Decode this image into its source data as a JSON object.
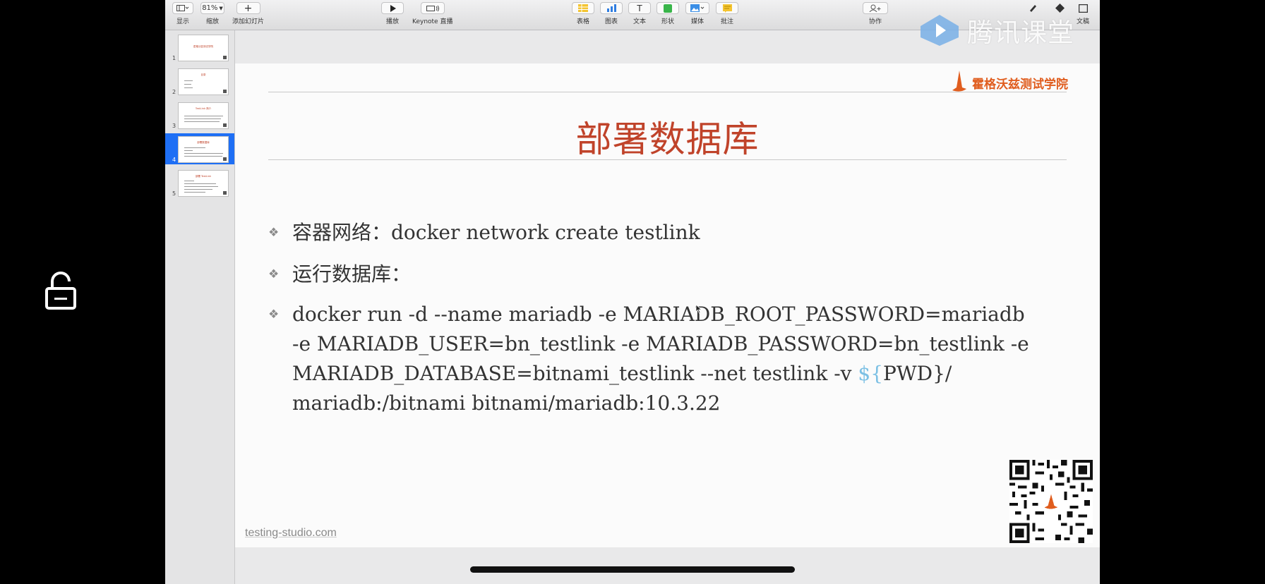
{
  "toolbar": {
    "view_label": "显示",
    "zoom_value": "81%",
    "zoom_label": "缩放",
    "add_slide_label": "添加幻灯片",
    "play_label": "播放",
    "keynote_live_label": "Keynote 直播",
    "table_label": "表格",
    "chart_label": "图表",
    "text_label": "文本",
    "text_glyph": "T",
    "shape_label": "形状",
    "media_label": "媒体",
    "comment_label": "批注",
    "collaborate_label": "协作",
    "document_label": "文稿"
  },
  "sidebar": {
    "slides": [
      {
        "number": "1",
        "title": "霍格沃兹测试学院"
      },
      {
        "number": "2",
        "title": "目录"
      },
      {
        "number": "3",
        "title": "TestLink 简介"
      },
      {
        "number": "4",
        "title": "部署数据库",
        "selected": true
      },
      {
        "number": "5",
        "title": "部署 TestLink"
      }
    ]
  },
  "slide": {
    "brand": "霍格沃兹测试学院",
    "title": "部署数据库",
    "bullets": {
      "network": "容器网络：docker network create testlink",
      "run_db": "运行数据库：",
      "cmd_line1": "docker run -d --name mariadb -e MARIADB_ROOT_PASSWORD=mariadb",
      "cmd_line2": "-e MARIADB_USER=bn_testlink -e MARIADB_PASSWORD=bn_testlink -e",
      "cmd_line3a": "MARIADB_DATABASE=bitnami_testlink --net testlink -v ",
      "cmd_line3b": "${",
      "cmd_line3c": "PWD}/",
      "cmd_line4": "mariadb:/bitnami bitnami/mariadb:10.3.22"
    },
    "footer": "testing-studio.com"
  },
  "watermark": "腾讯课堂",
  "colors": {
    "title": "#c0432a",
    "brand": "#e05d1e",
    "accent_variable": "#7cc0e4",
    "selection": "#1e6ff5"
  }
}
